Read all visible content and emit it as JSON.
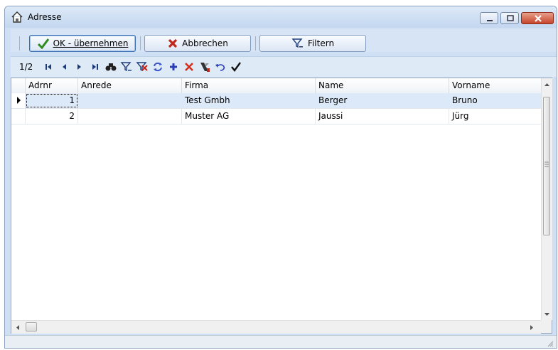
{
  "window": {
    "title": "Adresse",
    "icon": "house-icon"
  },
  "toolbar": {
    "ok_label": "OK - übernehmen",
    "cancel_label": "Abbrechen",
    "filter_label": "Filtern"
  },
  "nav": {
    "position": "1/2",
    "icons": [
      "first-record-icon",
      "prev-record-icon",
      "next-record-icon",
      "last-record-icon",
      "find-icon",
      "filter-icon",
      "clear-filter-icon",
      "refresh-icon",
      "add-record-icon",
      "delete-record-icon",
      "settings-icon",
      "undo-icon",
      "confirm-icon"
    ]
  },
  "table": {
    "columns": [
      "Adrnr",
      "Anrede",
      "Firma",
      "Name",
      "Vorname"
    ],
    "rows": [
      {
        "adrnr": "1",
        "anrede": "",
        "firma": "Test Gmbh",
        "name": "Berger",
        "vorname": "Bruno"
      },
      {
        "adrnr": "2",
        "anrede": "",
        "firma": "Muster AG",
        "name": "Jaussi",
        "vorname": "Jürg"
      }
    ]
  },
  "colors": {
    "titlebar": "#c3d7f0",
    "selection": "#dbe9f8",
    "close": "#c7452c",
    "ok_check": "#2e8b1e",
    "cancel_x": "#c0281b"
  }
}
